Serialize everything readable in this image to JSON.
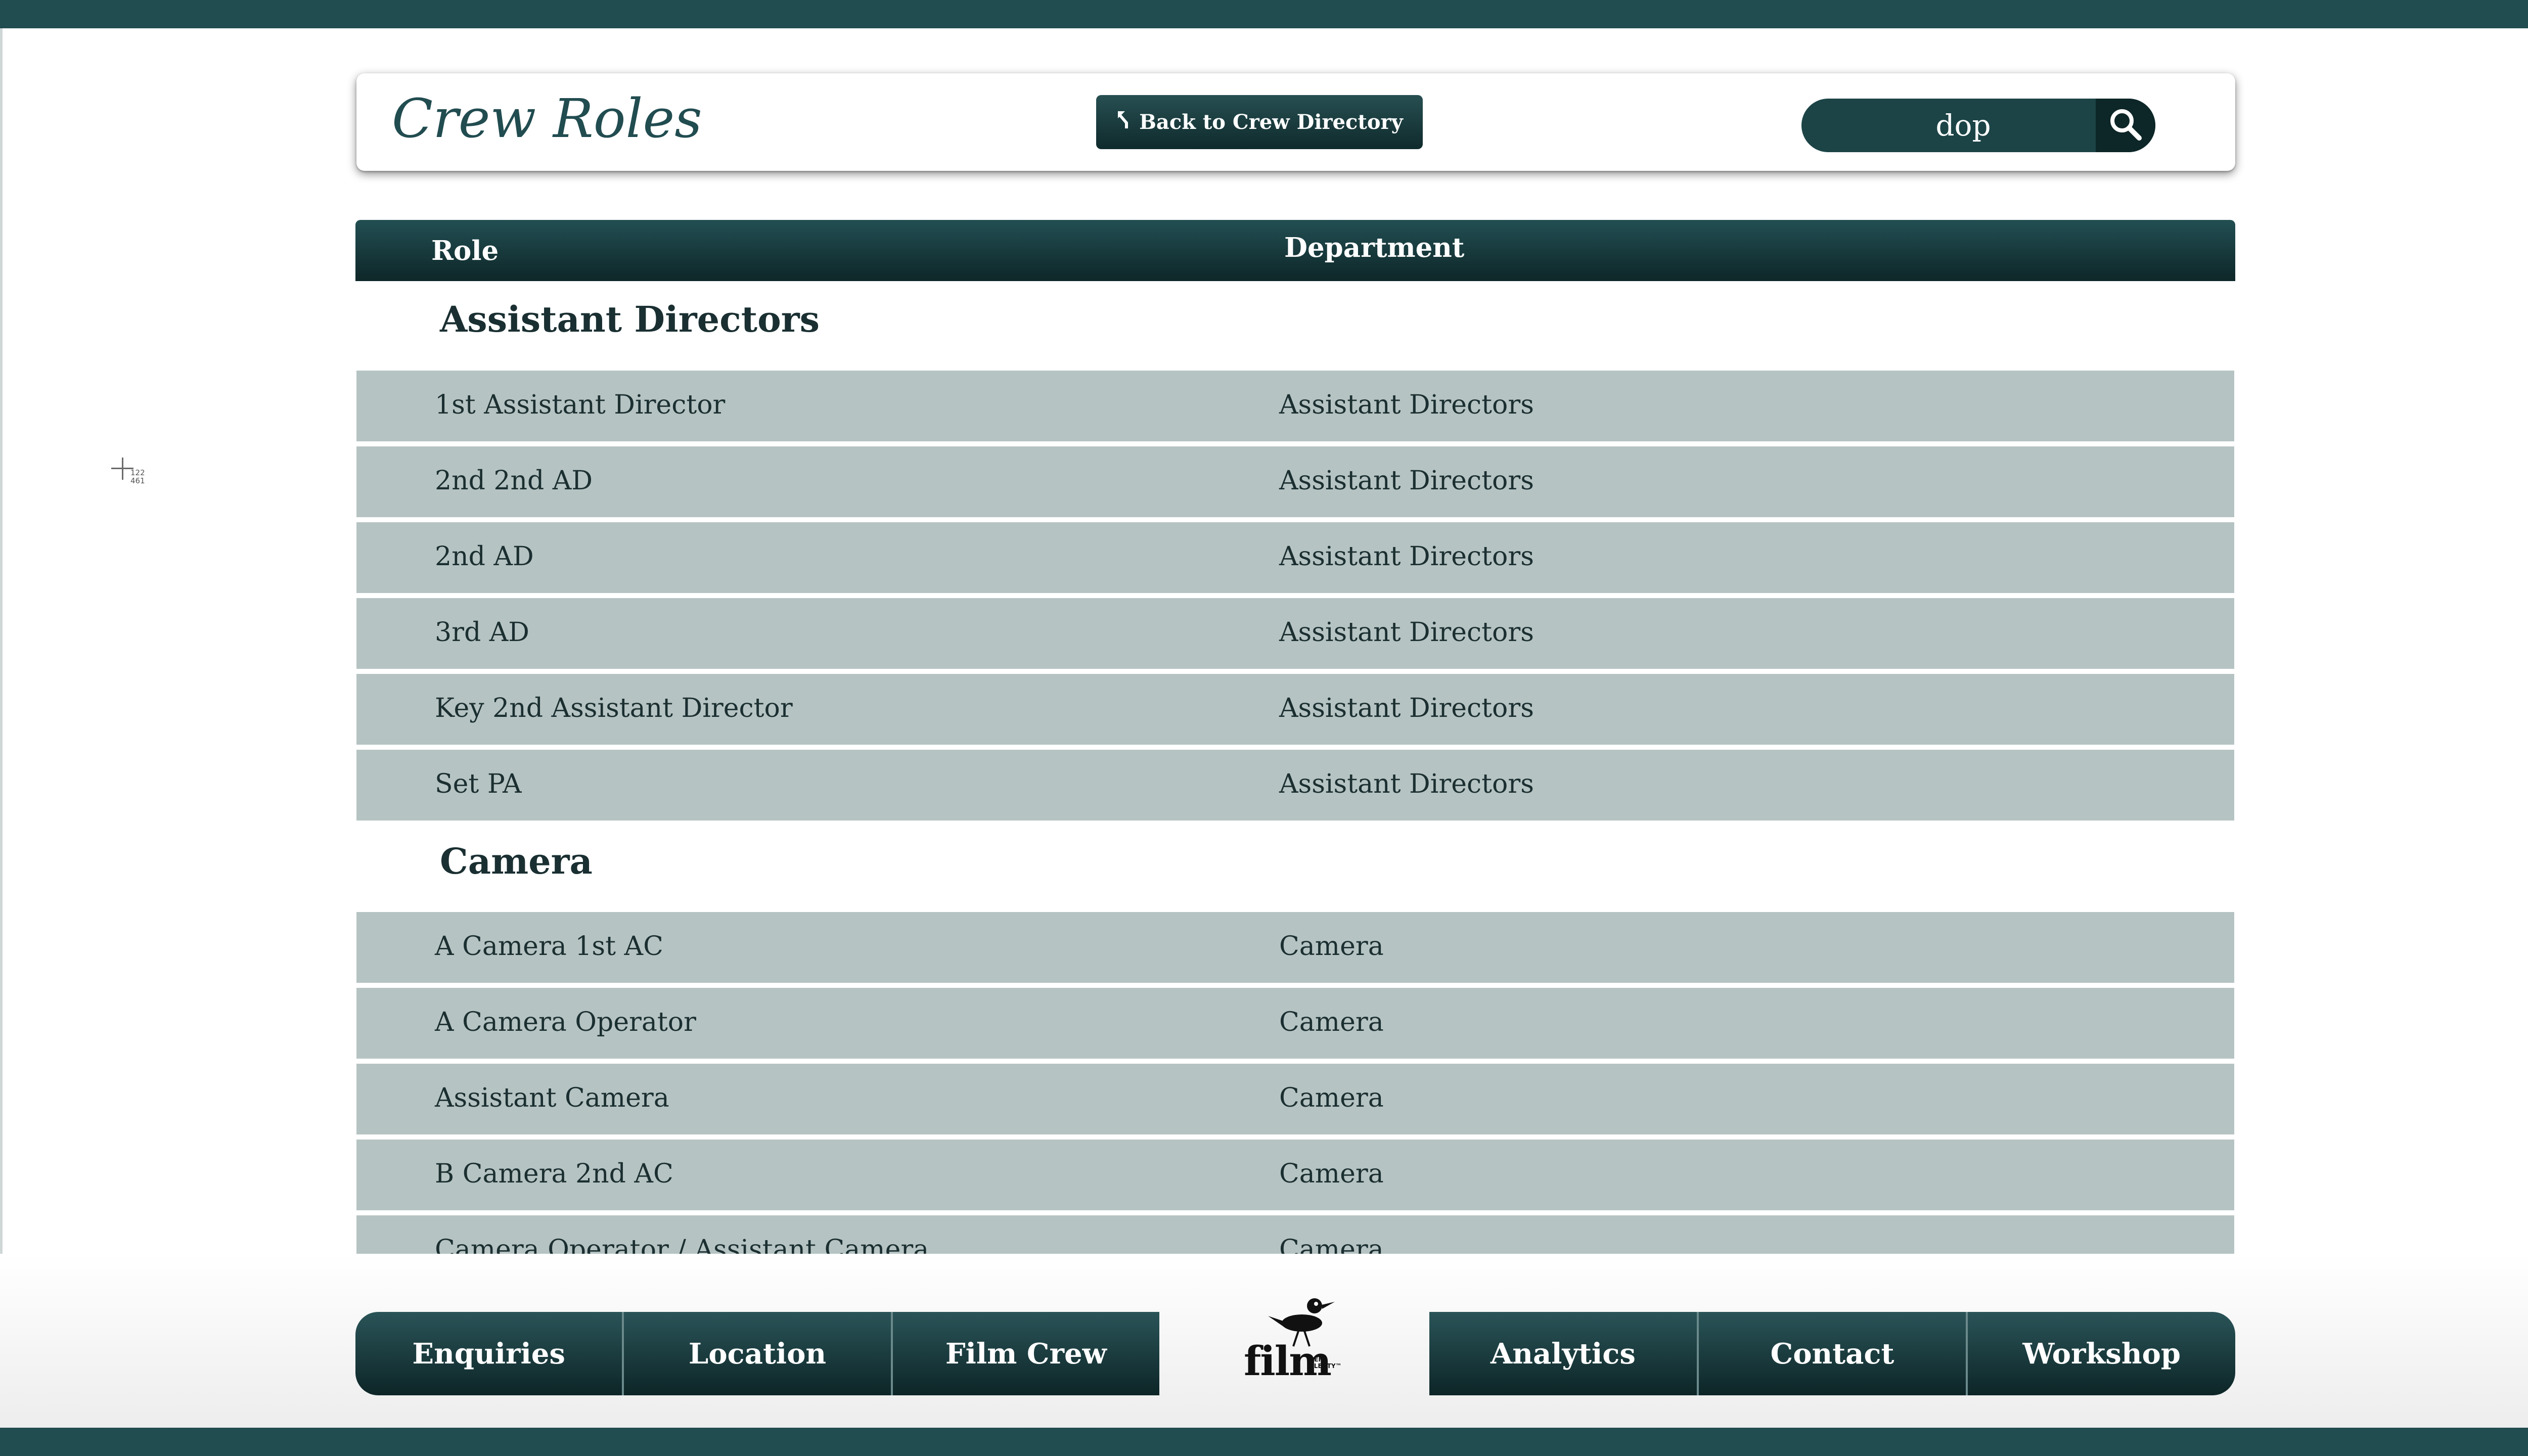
{
  "header": {
    "title": "Crew Roles",
    "back_label": "Back to Crew  Directory",
    "search_value": "dop"
  },
  "table": {
    "columns": [
      "Role",
      "Department"
    ],
    "groups": [
      {
        "name": "Assistant Directors",
        "rows": [
          {
            "role": "1st Assistant Director",
            "department": "Assistant Directors"
          },
          {
            "role": "2nd 2nd AD",
            "department": "Assistant Directors"
          },
          {
            "role": "2nd AD",
            "department": "Assistant Directors"
          },
          {
            "role": "3rd AD",
            "department": "Assistant Directors"
          },
          {
            "role": "Key 2nd Assistant Director",
            "department": "Assistant Directors"
          },
          {
            "role": "Set PA",
            "department": "Assistant Directors"
          }
        ]
      },
      {
        "name": "Camera",
        "rows": [
          {
            "role": "A Camera 1st AC",
            "department": "Camera"
          },
          {
            "role": "A Camera Operator",
            "department": "Camera"
          },
          {
            "role": "Assistant Camera",
            "department": "Camera"
          },
          {
            "role": "B Camera 2nd AC",
            "department": "Camera"
          },
          {
            "role": "Camera Operator / Assistant Camera",
            "department": "Camera"
          }
        ]
      }
    ]
  },
  "cursor": {
    "readout_x": "122",
    "readout_y": "461"
  },
  "footer": {
    "nav_left": [
      "Enquiries",
      "Location",
      "Film Crew"
    ],
    "nav_right": [
      "Analytics",
      "Contact",
      "Workshop"
    ],
    "logo_text": "film",
    "logo_small": [
      "REF",
      "PLENTY™"
    ]
  },
  "colors": {
    "brand": "#214c50",
    "row_bg": "#b6c3c3",
    "button_dark": "#0f2a2c"
  },
  "icons": {
    "back": "return-arrow-icon",
    "search": "search-icon",
    "logo": "bird-logo-icon"
  }
}
